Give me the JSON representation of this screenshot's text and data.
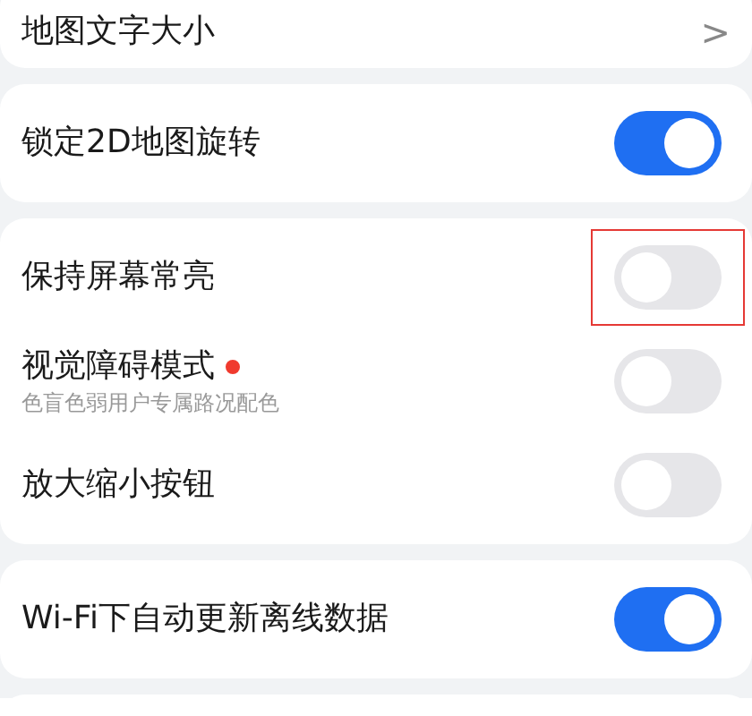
{
  "sections": [
    {
      "rows": [
        {
          "kind": "link",
          "label": "地图文字大小",
          "chevron": ">"
        }
      ]
    },
    {
      "rows": [
        {
          "kind": "toggle",
          "label": "锁定2D地图旋转",
          "on": true,
          "highlighted": false
        }
      ]
    },
    {
      "rows": [
        {
          "kind": "toggle",
          "label": "保持屏幕常亮",
          "on": false,
          "highlighted": true
        },
        {
          "kind": "toggle",
          "label": "视觉障碍模式",
          "subtitle": "色盲色弱用户专属路况配色",
          "new_dot": true,
          "on": false,
          "highlighted": false
        },
        {
          "kind": "toggle",
          "label": "放大缩小按钮",
          "on": false,
          "highlighted": false
        }
      ]
    },
    {
      "rows": [
        {
          "kind": "toggle",
          "label": "Wi-Fi下自动更新离线数据",
          "on": true,
          "highlighted": false
        }
      ]
    }
  ]
}
